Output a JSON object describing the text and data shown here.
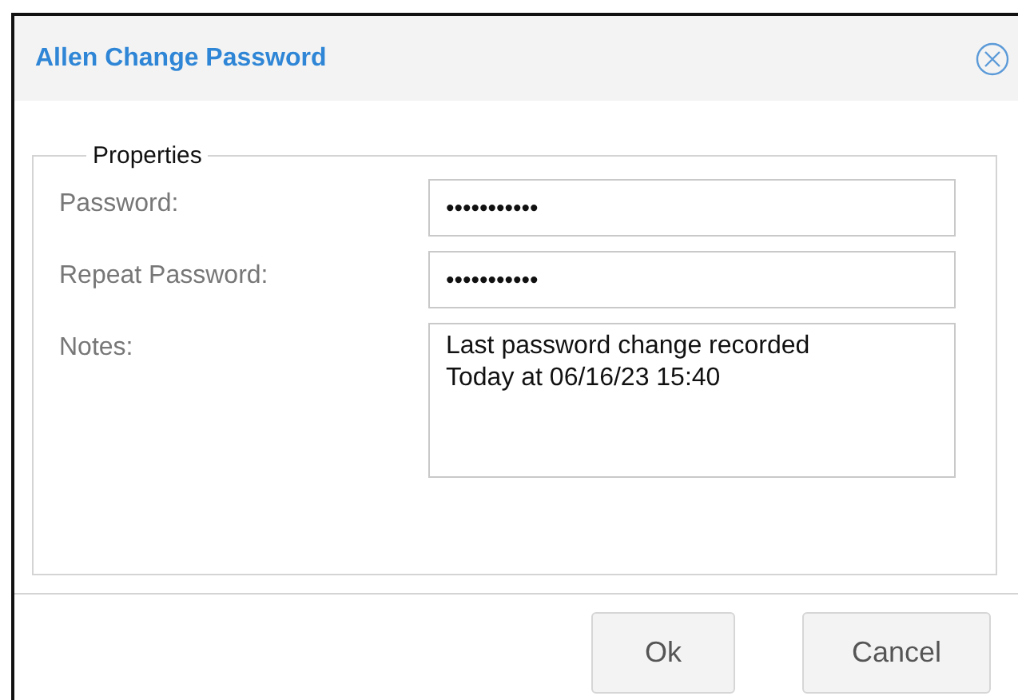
{
  "dialog": {
    "title": "Allen Change Password"
  },
  "properties": {
    "legend": "Properties",
    "fields": [
      {
        "kind": "input",
        "label": "Password:",
        "value": "•••••••••••"
      },
      {
        "kind": "input",
        "label": "Repeat Password:",
        "value": "•••••••••••"
      },
      {
        "kind": "textarea",
        "label": "Notes:",
        "value": "Last password change recorded\nToday at 06/16/23 15:40"
      }
    ]
  },
  "buttons": [
    "Ok",
    "Cancel"
  ]
}
